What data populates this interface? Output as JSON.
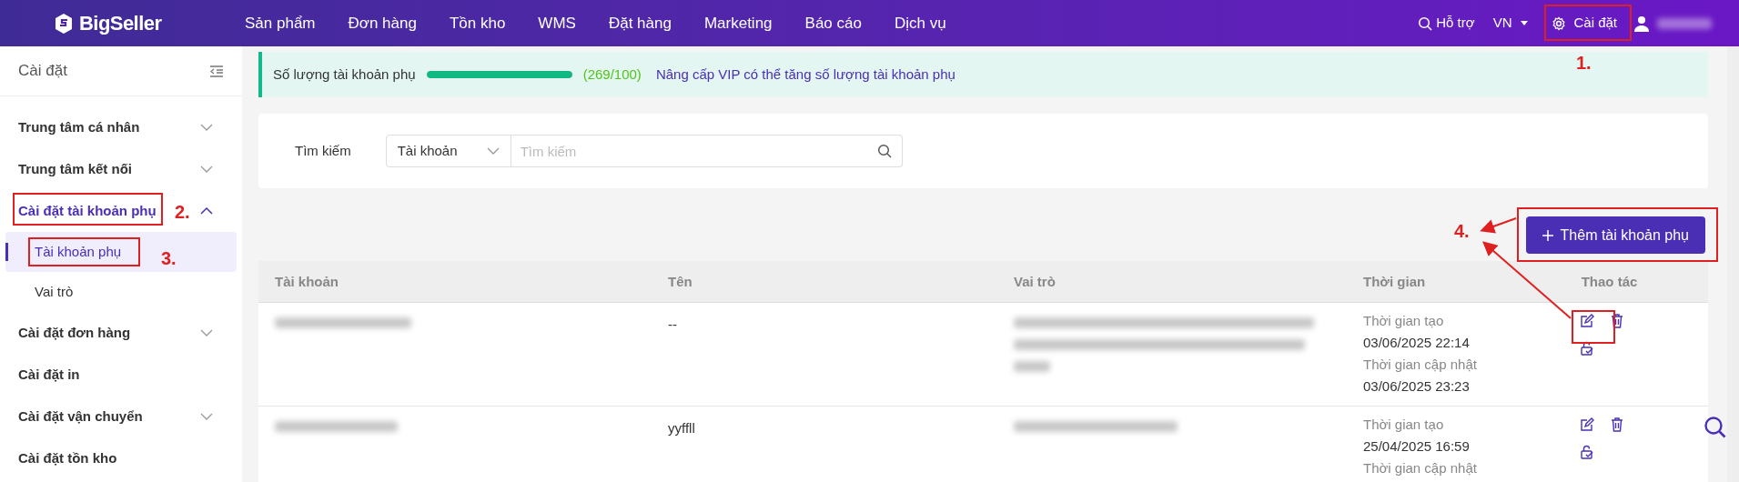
{
  "header": {
    "logo": "BigSeller",
    "nav": [
      {
        "label": "Sản phẩm"
      },
      {
        "label": "Đơn hàng"
      },
      {
        "label": "Tồn kho"
      },
      {
        "label": "WMS"
      },
      {
        "label": "Đặt hàng"
      },
      {
        "label": "Marketing"
      },
      {
        "label": "Báo cáo"
      },
      {
        "label": "Dịch vụ"
      }
    ],
    "help": "Hỗ trợ",
    "language": "VN",
    "settings": "Cài đặt"
  },
  "sidebar": {
    "title": "Cài đặt",
    "items": [
      {
        "label": "Trung tâm cá nhân",
        "expanded": false
      },
      {
        "label": "Trung tâm kết nối",
        "expanded": false
      },
      {
        "label": "Cài đặt tài khoản phụ",
        "expanded": true,
        "children": [
          {
            "label": "Tài khoản phụ",
            "selected": true
          },
          {
            "label": "Vai trò",
            "selected": false
          }
        ]
      },
      {
        "label": "Cài đặt đơn hàng",
        "expanded": false
      },
      {
        "label": "Cài đặt in"
      },
      {
        "label": "Cài đặt vận chuyển",
        "expanded": false
      },
      {
        "label": "Cài đặt tồn kho"
      }
    ]
  },
  "quota": {
    "label": "Số lượng tài khoản phụ",
    "level": 1,
    "count": "(269/100)",
    "upgrade_link": "Nâng cấp VIP có thể tăng số lượng tài khoản phụ"
  },
  "search": {
    "label": "Tìm kiếm",
    "field_select": "Tài khoản",
    "placeholder": "Tìm kiếm"
  },
  "add_button": "Thêm tài khoản phụ",
  "table": {
    "columns": [
      "Tài khoản",
      "Tên",
      "Vai trò",
      "Thời gian",
      "Thao tác"
    ],
    "rows": [
      {
        "name": "--",
        "times": [
          "Thời gian tạo",
          "03/06/2025 22:14",
          "Thời gian cập nhật",
          "03/06/2025 23:23"
        ]
      },
      {
        "name": "yyffll",
        "times": [
          "Thời gian tạo",
          "25/04/2025 16:59",
          "Thời gian cập nhật"
        ]
      }
    ]
  },
  "annotations": [
    {
      "label": "1."
    },
    {
      "label": "2."
    },
    {
      "label": "3."
    },
    {
      "label": "4."
    }
  ]
}
